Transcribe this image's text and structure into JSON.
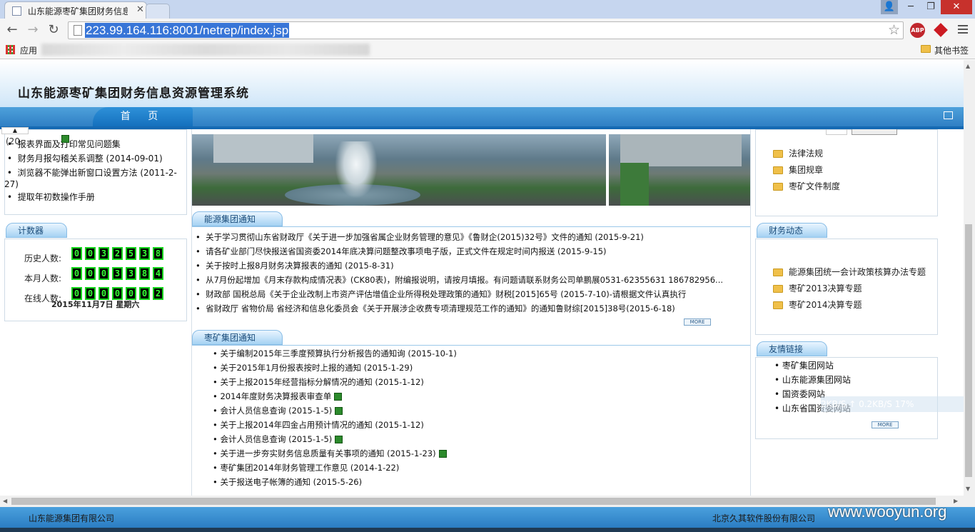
{
  "browser": {
    "tab_title": "山东能源枣矿集团财务信息",
    "url": "223.99.164.116:8001/netrep/index.jsp",
    "apps_label": "应用",
    "other_bookmarks": "其他书签",
    "abp_label": "ABP"
  },
  "site": {
    "title": "山东能源枣矿集团财务信息资源管理系统",
    "nav_home": "首  页"
  },
  "left": {
    "notice_partial": "(20",
    "notice_partial_2": "报表界面及打印常见问题集",
    "items": [
      "财务月报勾稽关系调整 (2014-09-01)",
      "浏览器不能弹出新窗口设置方法 (2011-2-27)",
      "提取年初数操作手册"
    ],
    "counter_title": "计数器",
    "counter_rows": [
      {
        "label": "历史人数:",
        "digits": [
          "0",
          "0",
          "3",
          "2",
          "5",
          "3",
          "8"
        ]
      },
      {
        "label": "本月人数:",
        "digits": [
          "0",
          "0",
          "0",
          "3",
          "3",
          "8",
          "4"
        ]
      },
      {
        "label": "在线人数:",
        "digits": [
          "0",
          "0",
          "0",
          "0",
          "0",
          "0",
          "2"
        ]
      }
    ],
    "date": "2015年11月7日 星期六"
  },
  "center": {
    "energy_title": "能源集团通知",
    "energy_news": [
      "关于学习贯彻山东省财政厅《关于进一步加强省属企业财务管理的意见》《鲁财企(2015)32号》文件的通知 (2015-9-21)",
      "请各矿业部门尽快报送省国资委2014年底决算问题整改事项电子版，正式文件在规定时间内报送 (2015-9-15)",
      "关于按时上报8月财务决算报表的通知 (2015-8-31)",
      "从7月份起增加《月末存款构成情况表》(CK80表)，附编报说明，请按月填报。有问题请联系财务公司单鹏展0531-62355631 186782956...",
      "财政部 国税总局《关于企业改制上市资产评估增值企业所得税处理政策的通知》财税[2015]65号 (2015-7-10)-请根据文件认真执行",
      "省财政厅 省物价局 省经济和信息化委员会《关于开展涉企收费专项清理规范工作的通知》的通知鲁财综[2015]38号(2015-6-18)"
    ],
    "more": "MORE",
    "zaokuang_title": "枣矿集团通知",
    "zaokuang_news": [
      {
        "text": "关于编制2015年三季度预算执行分析报告的通知询 (2015-10-1)",
        "disk": false
      },
      {
        "text": "关于2015年1月份报表按时上报的通知 (2015-1-29)",
        "disk": false
      },
      {
        "text": "关于上报2015年经营指标分解情况的通知 (2015-1-12)",
        "disk": false
      },
      {
        "text": "2014年度财务决算报表审查单",
        "disk": true
      },
      {
        "text": "会计人员信息查询 (2015-1-5)",
        "disk": true
      },
      {
        "text": "关于上报2014年四金占用预计情况的通知 (2015-1-12)",
        "disk": false
      },
      {
        "text": "会计人员信息查询 (2015-1-5)",
        "disk": true
      },
      {
        "text": "关于进一步夯实财务信息质量有关事项的通知 (2015-1-23)",
        "disk": true
      },
      {
        "text": "枣矿集团2014年财务管理工作意见 (2014-1-22)",
        "disk": false
      },
      {
        "text": "关于报送电子帐簿的通知 (2015-5-26)",
        "disk": false
      }
    ]
  },
  "right": {
    "folders_top": [
      "法律法规",
      "集团规章",
      "枣矿文件制度"
    ],
    "finance_title": "财务动态",
    "finance_folders": [
      "能源集团统一会计政策核算办法专题",
      "枣矿2013决算专题",
      "枣矿2014决算专题"
    ],
    "links_title": "友情链接",
    "links": [
      "枣矿集团网站",
      "山东能源集团网站",
      "国资委网站",
      "山东省国资委网站"
    ],
    "more": "MORE"
  },
  "overlay": {
    "speed_text": "2KB/S  ↑ 0.2KB/S   17%"
  },
  "footer": {
    "left": "山东能源集团有限公司",
    "right": "北京久其软件股份有限公司",
    "watermark": "www.wooyun.org"
  },
  "colors": {
    "nav_blue": "#2f7fc4",
    "url_highlight": "#3875d7",
    "counter_green": "#15d41c"
  }
}
